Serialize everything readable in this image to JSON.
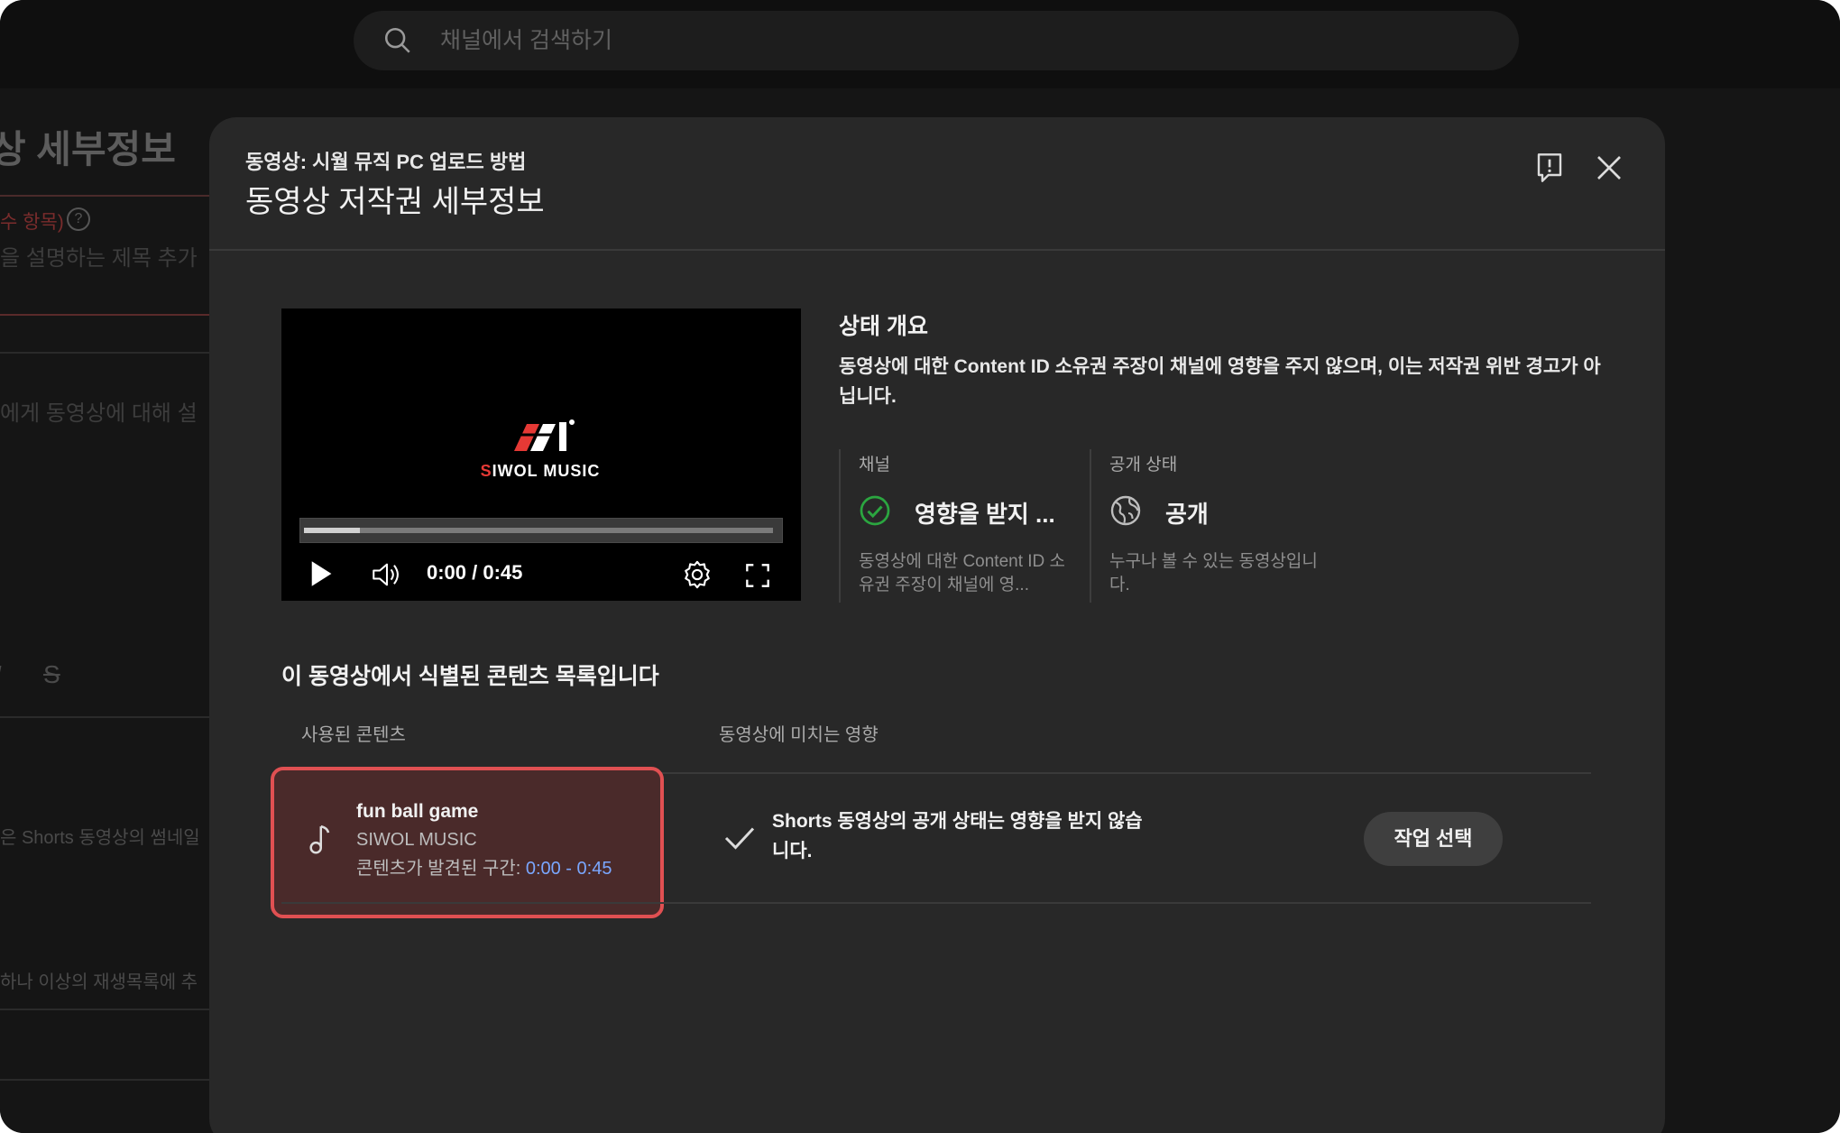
{
  "search": {
    "placeholder": "채널에서 검색하기"
  },
  "background_page": {
    "title": "상 세부정보",
    "required_note": "수 항목)",
    "title_placeholder": "을 설명하는 제목 추가",
    "description_placeholder": "에게 동영상에 대해 설",
    "format_buttons": [
      "I",
      "S"
    ],
    "thumbnail_note": "은 Shorts 동영상의 썸네일",
    "playlist_note": "하나 이상의 재생목록에 추"
  },
  "modal": {
    "subtitle": "동영상: 시월 뮤직 PC 업로드 방법",
    "title": "동영상 저작권 세부정보",
    "feedback_icon": "feedback-icon",
    "close_icon": "close-icon"
  },
  "video": {
    "brand": "SIWOL MUSIC",
    "brand_first": "S",
    "brand_rest": "IWOL MUSIC",
    "time": "0:00 / 0:45",
    "progress": 0.12
  },
  "status": {
    "heading": "상태 개요",
    "description": "동영상에 대한 Content ID 소유권 주장이 채널에 영향을 주지 않으며, 이는 저작권 위반 경고가 아닙니다.",
    "channel": {
      "label": "채널",
      "value": "영향을 받지 ...",
      "note": "동영상에 대한 Content ID 소유권 주장이 채널에 영...",
      "icon": "check-circle-icon",
      "color": "#2ba640"
    },
    "visibility": {
      "label": "공개 상태",
      "value": "공개",
      "note": "누구나 볼 수 있는 동영상입니다.",
      "icon": "globe-icon"
    }
  },
  "content_list": {
    "heading": "이 동영상에서 식별된 콘텐츠 목록입니다",
    "columns": [
      "사용된 콘텐츠",
      "동영상에 미치는 영향"
    ],
    "rows": [
      {
        "title": "fun ball game",
        "artist": "SIWOL MUSIC",
        "range_label": "콘텐츠가 발견된 구간: ",
        "range": "0:00 - 0:45",
        "impact": "Shorts 동영상의 공개 상태는 영향을 받지 않습니다.",
        "action": "작업 선택"
      }
    ]
  },
  "colors": {
    "highlight_border": "#e05052",
    "link": "#7aa7ff",
    "modal_bg": "#282828"
  }
}
